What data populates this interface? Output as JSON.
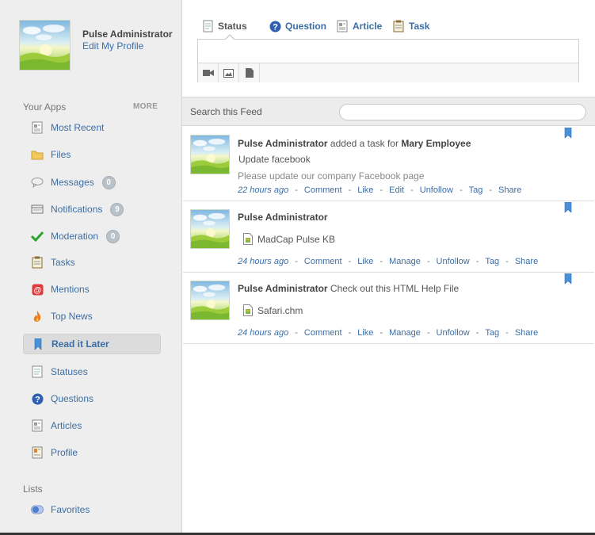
{
  "profile": {
    "name": "Pulse Administrator",
    "edit_link": "Edit My Profile"
  },
  "sidebar": {
    "apps_title": "Your Apps",
    "more_label": "MORE",
    "items": [
      {
        "label": "Most Recent",
        "icon": "article-icon"
      },
      {
        "label": "Files",
        "icon": "folder-icon"
      },
      {
        "label": "Messages",
        "icon": "speech-bubble-icon",
        "badge": "0"
      },
      {
        "label": "Notifications",
        "icon": "notification-icon",
        "badge": "9"
      },
      {
        "label": "Moderation",
        "icon": "checkmark-icon",
        "badge": "0"
      },
      {
        "label": "Tasks",
        "icon": "clipboard-icon"
      },
      {
        "label": "Mentions",
        "icon": "at-sign-icon"
      },
      {
        "label": "Top News",
        "icon": "flame-icon"
      },
      {
        "label": "Read it Later",
        "icon": "bookmark-icon",
        "active": true
      },
      {
        "label": "Statuses",
        "icon": "status-doc-icon"
      },
      {
        "label": "Questions",
        "icon": "question-icon"
      },
      {
        "label": "Articles",
        "icon": "article-icon"
      },
      {
        "label": "Profile",
        "icon": "profile-card-icon"
      }
    ],
    "lists_title": "Lists",
    "lists": [
      {
        "label": "Favorites",
        "icon": "toggle-icon"
      }
    ]
  },
  "composer": {
    "tabs": [
      {
        "label": "Status",
        "icon": "status-doc-icon",
        "active": true
      },
      {
        "label": "Question",
        "icon": "question-icon"
      },
      {
        "label": "Article",
        "icon": "article-icon"
      },
      {
        "label": "Task",
        "icon": "clipboard-icon"
      }
    ],
    "tools": [
      "video-icon",
      "image-icon",
      "document-icon"
    ]
  },
  "search": {
    "label": "Search this Feed",
    "value": ""
  },
  "feed": [
    {
      "author": "Pulse Administrator",
      "action": "added a task for",
      "target": "Mary Employee",
      "subject": "Update facebook",
      "description": "Please update our company Facebook page",
      "time": "22 hours ago",
      "actions": [
        "Comment",
        "Like",
        "Edit",
        "Unfollow",
        "Tag",
        "Share"
      ]
    },
    {
      "author": "Pulse Administrator",
      "action": "",
      "file": "MadCap Pulse KB",
      "time": "24 hours ago",
      "actions": [
        "Comment",
        "Like",
        "Manage",
        "Unfollow",
        "Tag",
        "Share"
      ]
    },
    {
      "author": "Pulse Administrator",
      "action": "Check out this HTML Help File",
      "file": "Safari.chm",
      "time": "24 hours ago",
      "actions": [
        "Comment",
        "Like",
        "Manage",
        "Unfollow",
        "Tag",
        "Share"
      ]
    }
  ],
  "colors": {
    "link": "#3b6ea5",
    "sidebar_bg": "#eeeeee",
    "bookmark": "#4a90d9"
  }
}
